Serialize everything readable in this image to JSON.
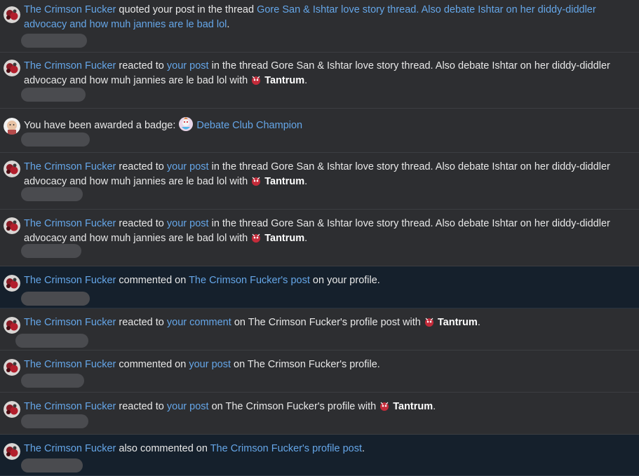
{
  "alerts": [
    {
      "user": "The Crimson Fucker",
      "action": "quoted your post in the thread",
      "thread": "Gore San & Ishtar love story thread. Also debate Ishtar on her diddy-diddler advocacy and how muh jannies are le bad lol",
      "end": "."
    },
    {
      "user": "The Crimson Fucker",
      "a1": "reacted to",
      "target": "your post",
      "a2": "in the thread Gore San & Ishtar love story thread. Also debate Ishtar on her diddy-diddler advocacy and how muh jannies are le bad lol with",
      "reaction": "Tantrum",
      "end": "."
    },
    {
      "text": "You have been awarded a badge:",
      "badge": "Debate Club Champion"
    },
    {
      "user": "The Crimson Fucker",
      "a1": "reacted to",
      "target": "your post",
      "a2": "in the thread Gore San & Ishtar love story thread. Also debate Ishtar on her diddy-diddler advocacy and how muh jannies are le bad lol with",
      "reaction": "Tantrum",
      "end": "."
    },
    {
      "user": "The Crimson Fucker",
      "a1": "reacted to",
      "target": "your post",
      "a2": "in the thread Gore San & Ishtar love story thread. Also debate Ishtar on her diddy-diddler advocacy and how muh jannies are le bad lol with",
      "reaction": "Tantrum",
      "end": "."
    },
    {
      "user": "The Crimson Fucker",
      "a1": "commented on",
      "target": "The Crimson Fucker's post",
      "a2": "on your profile."
    },
    {
      "user": "The Crimson Fucker",
      "a1": "reacted to",
      "target": "your comment",
      "a2": "on The Crimson Fucker's profile post with",
      "reaction": "Tantrum",
      "end": "."
    },
    {
      "user": "The Crimson Fucker",
      "a1": "commented on",
      "target": "your post",
      "a2": "on The Crimson Fucker's profile."
    },
    {
      "user": "The Crimson Fucker",
      "a1": "reacted to",
      "target": "your post",
      "a2": "on The Crimson Fucker's profile with",
      "reaction": "Tantrum",
      "end": "."
    },
    {
      "user": "The Crimson Fucker",
      "a1": "also commented on",
      "target": "The Crimson Fucker's profile post",
      "end": "."
    }
  ],
  "colors": {
    "background": "#2d2e31",
    "unread_background": "#15202c",
    "link": "#65a6e8",
    "text": "#e8e8e8"
  },
  "icons": {
    "user_avatar": "crimson-avatar-icon",
    "system_avatar": "bald-avatar-icon",
    "reaction": "tantrum-reaction-icon",
    "badge": "badge-trophy-icon"
  }
}
